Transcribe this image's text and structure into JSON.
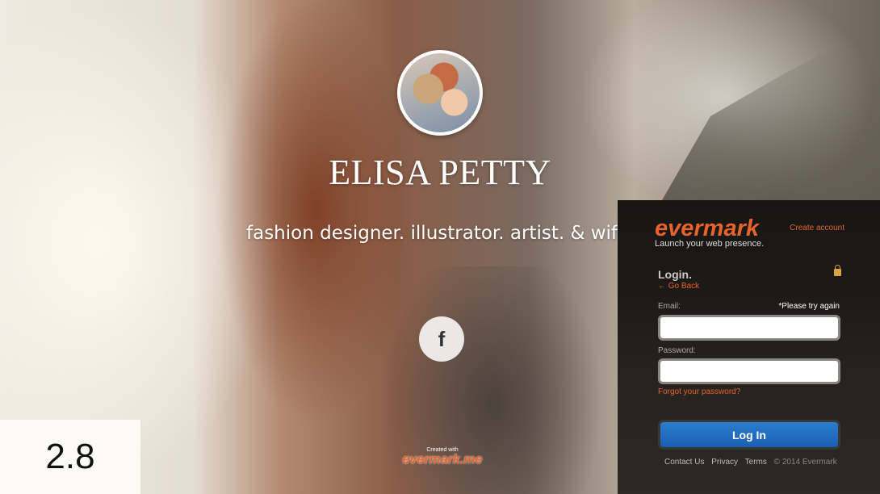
{
  "profile": {
    "name": "ELISA PETTY",
    "tagline": "fashion designer. illustrator. artist. & wife",
    "social_icon": "f",
    "created_with": "Created with",
    "created_logo": "evermark.me"
  },
  "badge": "2.8",
  "login_panel": {
    "brand": "evermark",
    "brand_sub": "Launch your web presence.",
    "create_account": "Create account",
    "title": "Login.",
    "go_back": "← Go Back",
    "email_label": "Email:",
    "error": "*Please try again",
    "email_value": "",
    "password_label": "Password:",
    "password_value": "",
    "forgot": "Forgot your password?",
    "login_button": "Log In",
    "footer": {
      "contact": "Contact Us",
      "privacy": "Privacy",
      "terms": "Terms",
      "copyright": "© 2014 Evermark"
    }
  },
  "colors": {
    "accent": "#e8632b",
    "button": "#1a6fc2",
    "panel": "#1c1a18"
  },
  "icons": [
    "facebook-icon",
    "lock-icon"
  ]
}
